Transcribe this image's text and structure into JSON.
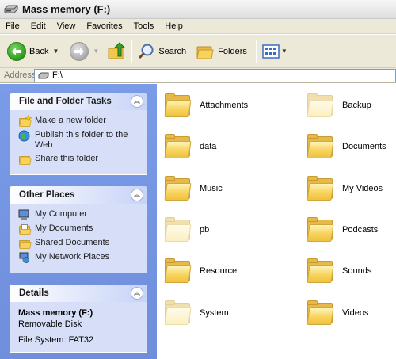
{
  "window": {
    "title": "Mass memory (F:)"
  },
  "menu": [
    "File",
    "Edit",
    "View",
    "Favorites",
    "Tools",
    "Help"
  ],
  "toolbar": {
    "back_label": "Back",
    "search_label": "Search",
    "folders_label": "Folders"
  },
  "address": {
    "label": "Address",
    "value": "F:\\"
  },
  "tasks_panel": {
    "title": "File and Folder Tasks",
    "items": [
      {
        "label": "Make a new folder",
        "icon": "new-folder-icon"
      },
      {
        "label": "Publish this folder to the Web",
        "icon": "globe-icon"
      },
      {
        "label": "Share this folder",
        "icon": "share-folder-icon"
      }
    ]
  },
  "places_panel": {
    "title": "Other Places",
    "items": [
      {
        "label": "My Computer",
        "icon": "computer-icon"
      },
      {
        "label": "My Documents",
        "icon": "documents-icon"
      },
      {
        "label": "Shared Documents",
        "icon": "folder-icon"
      },
      {
        "label": "My Network Places",
        "icon": "network-icon"
      }
    ]
  },
  "details_panel": {
    "title": "Details",
    "name": "Mass memory (F:)",
    "type": "Removable Disk",
    "filesystem": "File System: FAT32"
  },
  "folders": [
    {
      "name": "Attachments",
      "hidden": false
    },
    {
      "name": "Backup",
      "hidden": true
    },
    {
      "name": "data",
      "hidden": false
    },
    {
      "name": "Documents",
      "hidden": false
    },
    {
      "name": "Music",
      "hidden": false
    },
    {
      "name": "My Videos",
      "hidden": false
    },
    {
      "name": "pb",
      "hidden": true
    },
    {
      "name": "Podcasts",
      "hidden": false
    },
    {
      "name": "Resource",
      "hidden": false
    },
    {
      "name": "Sounds",
      "hidden": false
    },
    {
      "name": "System",
      "hidden": true
    },
    {
      "name": "Videos",
      "hidden": false
    }
  ],
  "colors": {
    "taskpane_bg": "#7a9be8",
    "panel_body": "#d6dff7",
    "toolbar_bg": "#ece9d8",
    "folder": "#f7d35c"
  }
}
